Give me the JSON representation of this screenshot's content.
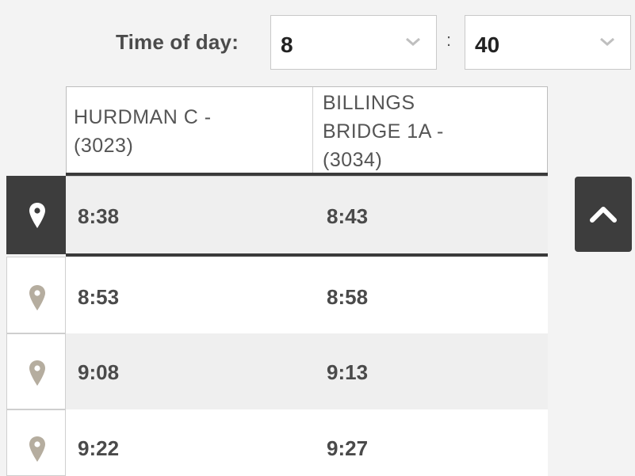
{
  "time_of_day": {
    "label": "Time of day:",
    "hour": "8",
    "separator": ":",
    "minute": "40"
  },
  "table": {
    "columns": [
      {
        "line1": "HURDMAN C -",
        "line2": "(3023)",
        "line3": ""
      },
      {
        "line1": "BILLINGS",
        "line2": "BRIDGE 1A -",
        "line3": "(3034)"
      }
    ],
    "rows": [
      {
        "times": [
          "8:38",
          "8:43"
        ],
        "selected": true
      },
      {
        "times": [
          "8:53",
          "8:58"
        ],
        "selected": false
      },
      {
        "times": [
          "9:08",
          "9:13"
        ],
        "selected": false
      },
      {
        "times": [
          "9:22",
          "9:27"
        ],
        "selected": false
      }
    ]
  },
  "icons": {
    "row_pin": "map-pin-icon",
    "chevron": "chevron-down-icon",
    "collapse": "chevron-up-icon"
  },
  "colors": {
    "dark": "#3d3d3d",
    "pin_inactive": "#b5ad9f",
    "pin_active": "#ffffff",
    "row_alt": "#efefef"
  }
}
